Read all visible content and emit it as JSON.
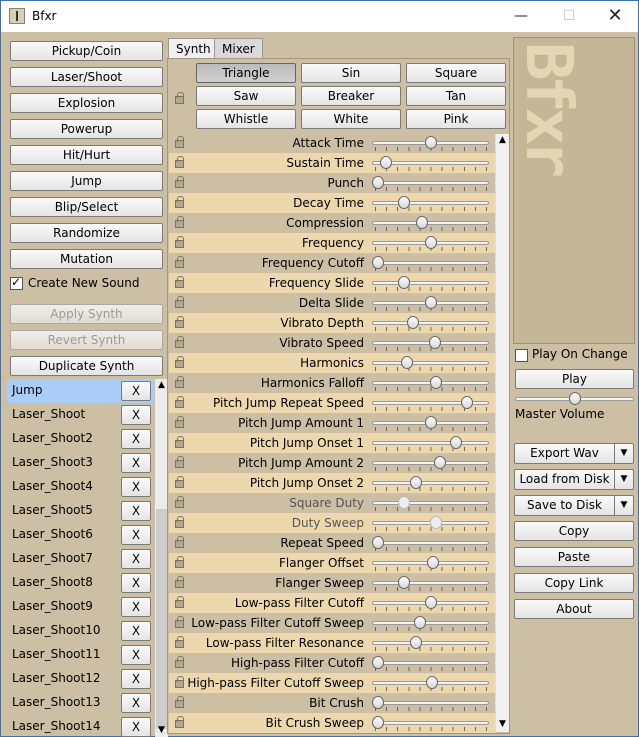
{
  "window": {
    "title": "Bfxr",
    "minimize": "—",
    "maximize": "☐",
    "close": "✕"
  },
  "generators": [
    "Pickup/Coin",
    "Laser/Shoot",
    "Explosion",
    "Powerup",
    "Hit/Hurt",
    "Jump",
    "Blip/Select",
    "Randomize",
    "Mutation"
  ],
  "create_new": {
    "label": "Create New Sound",
    "checked": true
  },
  "synth_actions": {
    "apply": "Apply Synth",
    "revert": "Revert Synth",
    "duplicate": "Duplicate Synth"
  },
  "sounds": [
    "Jump",
    "Laser_Shoot",
    "Laser_Shoot2",
    "Laser_Shoot3",
    "Laser_Shoot4",
    "Laser_Shoot5",
    "Laser_Shoot6",
    "Laser_Shoot7",
    "Laser_Shoot8",
    "Laser_Shoot9",
    "Laser_Shoot10",
    "Laser_Shoot11",
    "Laser_Shoot12",
    "Laser_Shoot13",
    "Laser_Shoot14"
  ],
  "sound_delete": "X",
  "list_scroll": {
    "up": "▲",
    "down": "▼"
  },
  "tabs": [
    "Synth",
    "Mixer"
  ],
  "waveforms": [
    "Triangle",
    "Sin",
    "Square",
    "Saw",
    "Breaker",
    "Tan",
    "Whistle",
    "White",
    "Pink"
  ],
  "selected_waveform": "Triangle",
  "params": [
    {
      "label": "Attack Time",
      "value": 0.5
    },
    {
      "label": "Sustain Time",
      "value": 0.08
    },
    {
      "label": "Punch",
      "value": 0.0
    },
    {
      "label": "Decay Time",
      "value": 0.25
    },
    {
      "label": "Compression",
      "value": 0.42
    },
    {
      "label": "Frequency",
      "value": 0.5
    },
    {
      "label": "Frequency Cutoff",
      "value": 0.0
    },
    {
      "label": "Frequency Slide",
      "value": 0.25
    },
    {
      "label": "Delta Slide",
      "value": 0.5
    },
    {
      "label": "Vibrato Depth",
      "value": 0.33
    },
    {
      "label": "Vibrato Speed",
      "value": 0.54
    },
    {
      "label": "Harmonics",
      "value": 0.28
    },
    {
      "label": "Harmonics Falloff",
      "value": 0.55
    },
    {
      "label": "Pitch Jump Repeat Speed",
      "value": 0.85
    },
    {
      "label": "Pitch Jump Amount 1",
      "value": 0.5
    },
    {
      "label": "Pitch Jump Onset 1",
      "value": 0.74
    },
    {
      "label": "Pitch Jump Amount 2",
      "value": 0.59
    },
    {
      "label": "Pitch Jump Onset 2",
      "value": 0.36
    },
    {
      "label": "Square Duty",
      "value": 0.25,
      "disabled": true
    },
    {
      "label": "Duty Sweep",
      "value": 0.55,
      "disabled": true
    },
    {
      "label": "Repeat Speed",
      "value": 0.0
    },
    {
      "label": "Flanger Offset",
      "value": 0.52
    },
    {
      "label": "Flanger Sweep",
      "value": 0.25
    },
    {
      "label": "Low-pass Filter Cutoff",
      "value": 0.5
    },
    {
      "label": "Low-pass Filter Cutoff Sweep",
      "value": 0.4
    },
    {
      "label": "Low-pass Filter Resonance",
      "value": 0.36
    },
    {
      "label": "High-pass Filter Cutoff",
      "value": 0.0
    },
    {
      "label": "High-pass Filter Cutoff Sweep",
      "value": 0.51
    },
    {
      "label": "Bit Crush",
      "value": 0.0
    },
    {
      "label": "Bit Crush Sweep",
      "value": 0.0
    }
  ],
  "params_scroll": {
    "up": "▲",
    "down": "▼"
  },
  "logo": "Bfxr",
  "play_on_change": {
    "label": "Play On Change",
    "checked": false
  },
  "play": "Play",
  "master_volume": {
    "label": "Master Volume",
    "value": 0.5
  },
  "dropdown_arrow": "▼",
  "actions": [
    {
      "label": "Export Wav",
      "dropdown": true
    },
    {
      "label": "Load from Disk",
      "dropdown": true
    },
    {
      "label": "Save to Disk",
      "dropdown": true
    },
    {
      "label": "Copy",
      "dropdown": false
    },
    {
      "label": "Paste",
      "dropdown": false
    },
    {
      "label": "Copy Link",
      "dropdown": false
    },
    {
      "label": "About",
      "dropdown": false
    }
  ]
}
